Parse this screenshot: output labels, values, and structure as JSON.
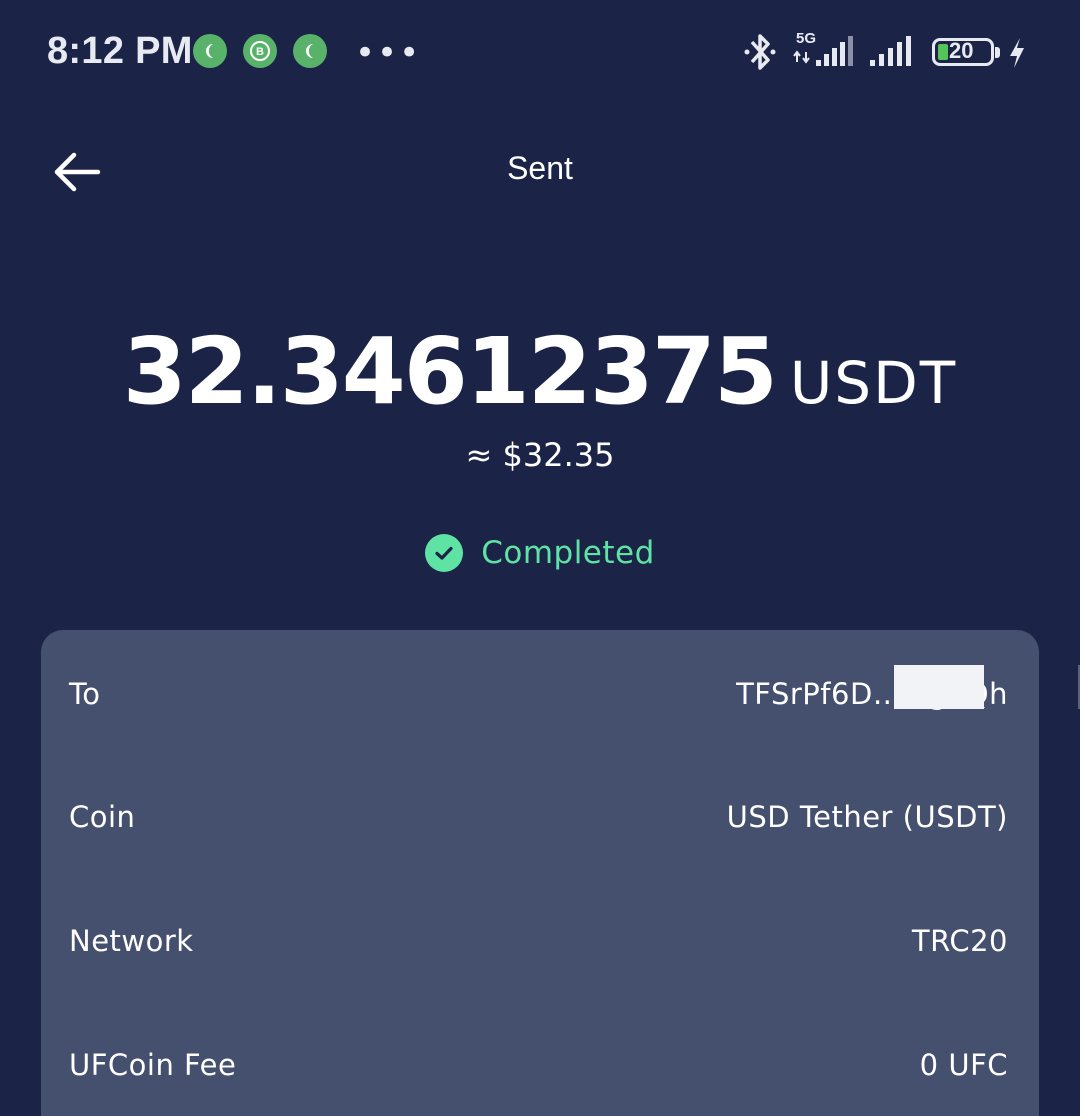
{
  "status_bar": {
    "time": "8:12 PM",
    "notification_icons": [
      "chat-icon",
      "business-chat-icon",
      "chat-icon"
    ],
    "more": "•••",
    "network_type": "5G",
    "battery_level": "20",
    "charging": true
  },
  "header": {
    "title": "Sent",
    "back_icon": "arrow-left-icon"
  },
  "amount": {
    "value": "32.34612375",
    "unit": "USDT",
    "fiat": "≈ $32.35"
  },
  "status": {
    "label": "Completed",
    "icon": "check-circle-icon",
    "color": "#5fe3a5"
  },
  "details": {
    "to": {
      "label": "To",
      "value": "TFSrPf6D…fsgaQh"
    },
    "coin": {
      "label": "Coin",
      "value": "USD Tether (USDT)"
    },
    "network": {
      "label": "Network",
      "value": "TRC20"
    },
    "fee": {
      "label": "UFCoin Fee",
      "value": "0 UFC"
    }
  },
  "colors": {
    "background": "#1b2347",
    "card": "#454f6e",
    "accent": "#5fe3a5"
  }
}
